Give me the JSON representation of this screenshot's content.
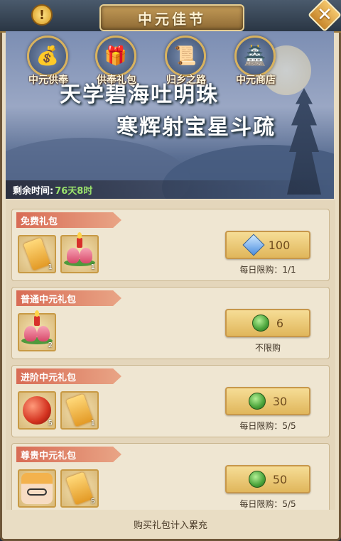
{
  "title": "中元佳节",
  "banner": {
    "poem_line1": "天学碧海吐明珠",
    "poem_line2": "寒辉射宝星斗疏",
    "remaining_label": "剩余时间:",
    "remaining_value": "76天8时"
  },
  "tabs": [
    {
      "label": "中元供奉",
      "icon": "gold-offering-icon"
    },
    {
      "label": "供奉礼包",
      "icon": "gift-bag-icon"
    },
    {
      "label": "归乡之路",
      "icon": "scroll-map-icon"
    },
    {
      "label": "中元商店",
      "icon": "shop-pavilion-icon"
    }
  ],
  "packs": [
    {
      "title": "免费礼包",
      "items": [
        {
          "type": "coupon",
          "count": "1"
        },
        {
          "type": "lotus-lantern",
          "count": "1"
        }
      ],
      "price": "100",
      "currency": "gem",
      "limit": "每日限购：1/1"
    },
    {
      "title": "普通中元礼包",
      "items": [
        {
          "type": "lotus-lantern",
          "count": "2"
        }
      ],
      "price": "6",
      "currency": "jade",
      "limit": "不限购"
    },
    {
      "title": "进阶中元礼包",
      "items": [
        {
          "type": "red-orb",
          "count": "5"
        },
        {
          "type": "coupon",
          "count": "1"
        }
      ],
      "price": "30",
      "currency": "jade",
      "limit": "每日限购：5/5"
    },
    {
      "title": "尊贵中元礼包",
      "items": [
        {
          "type": "character-avatar",
          "count": ""
        },
        {
          "type": "coupon",
          "count": "5"
        }
      ],
      "price": "50",
      "currency": "jade",
      "limit": "每日限购：5/5"
    }
  ],
  "footer_text": "购买礼包计入累充",
  "colors": {
    "title_gold": "#c29a57",
    "pack_title_red": "#d86c55",
    "remaining_green": "#9be36c",
    "price_button": "#f6dd96"
  }
}
